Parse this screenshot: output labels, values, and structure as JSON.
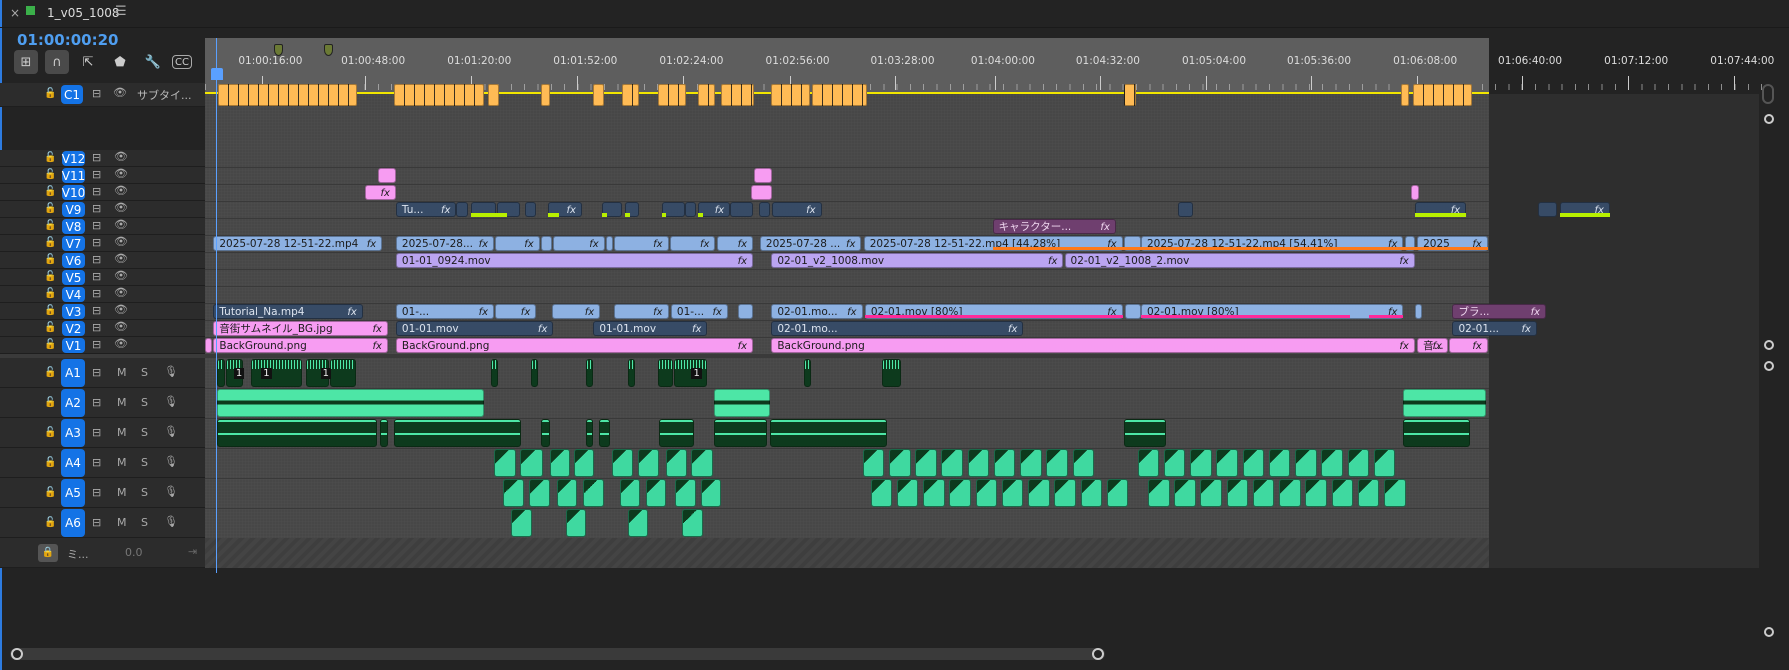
{
  "panel": {
    "title": "1_v05_1008",
    "close_label": "×",
    "menu_label": "☰"
  },
  "timecode": "01:00:00:20",
  "toolbar": {
    "insert": "⊞",
    "snap": "∩",
    "linked": "⇱",
    "marker": "⬟",
    "settings": "🔧",
    "captions": "CC"
  },
  "ruler_labels": [
    "01:00:16:00",
    "01:00:48:00",
    "01:01:20:00",
    "01:01:52:00",
    "01:02:24:00",
    "01:02:56:00",
    "01:03:28:00",
    "01:04:00:00",
    "01:04:32:00",
    "01:05:04:00",
    "01:05:36:00",
    "01:06:08:00",
    "01:06:40:00",
    "01:07:12:00",
    "01:07:44:00"
  ],
  "subtitle_track": {
    "badge": "C1",
    "label": "サブタイ..."
  },
  "video_tracks": [
    "V12",
    "V11",
    "V10",
    "V9",
    "V8",
    "V7",
    "V6",
    "V5",
    "V4",
    "V3",
    "V2",
    "V1"
  ],
  "audio_tracks": [
    "A1",
    "A2",
    "A3",
    "A4",
    "A5",
    "A6"
  ],
  "audio_buttons": {
    "mute": "M",
    "solo": "S"
  },
  "mix_track": {
    "label": "ミ...",
    "value": "0.0"
  },
  "fx_label": "fx",
  "clips": {
    "v9": [
      "Tu..."
    ],
    "v8": [
      "キャラクター..."
    ],
    "v7": [
      "2025-07-28 12-51-22.mp4",
      "2025-07-28...",
      "2025-07-28 ...",
      "2025-07-28 12-51-22.mp4 [44.28%]",
      "2025-07-28 12-51-22.mp4 [54.41%]",
      "2025"
    ],
    "v6": [
      "01-01_0924.mov",
      "02-01_v2_1008.mov",
      "02-01_v2_1008_2.mov"
    ],
    "v3": [
      "Tutorial_Na.mp4",
      "01-...",
      "01-...",
      "02-01.mo...",
      "02-01.mov [80%]",
      "02-01.mov [80%]",
      "ブラ..."
    ],
    "v2": [
      "音街サムネイル_BG.jpg",
      "01-01.mov",
      "01-01.mov",
      "02-01.mo...",
      "02-01..."
    ],
    "v1": [
      "BackGround.png",
      "BackGround.png",
      "BackGround.png",
      "音..."
    ],
    "a1": [
      "1",
      "1",
      "1",
      "1"
    ]
  }
}
